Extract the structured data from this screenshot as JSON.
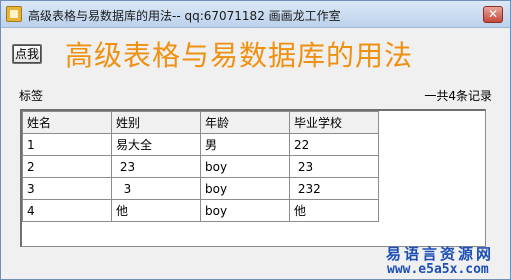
{
  "window": {
    "title": "高级表格与易数据库的用法-- qq:67071182 画画龙工作室",
    "close_label": "✕"
  },
  "toolbar": {
    "click_button_label": "点我"
  },
  "main": {
    "heading": "高级表格与易数据库的用法",
    "tag_label": "标签",
    "record_count": "一共4条记录"
  },
  "grid": {
    "columns": [
      "姓名",
      "姓别",
      "年龄",
      "毕业学校"
    ],
    "rows": [
      [
        "1",
        "易大全",
        "男",
        "22"
      ],
      [
        "2",
        " 23",
        "boy",
        " 23"
      ],
      [
        "3",
        "  3",
        "boy",
        " 232"
      ],
      [
        "4",
        "他",
        "boy",
        "他"
      ]
    ]
  },
  "watermark": {
    "text": "易语言资源网",
    "url": "www.e5a5x.com"
  },
  "colors": {
    "heading": "#f0900f",
    "watermark": "#1e4fb5"
  }
}
